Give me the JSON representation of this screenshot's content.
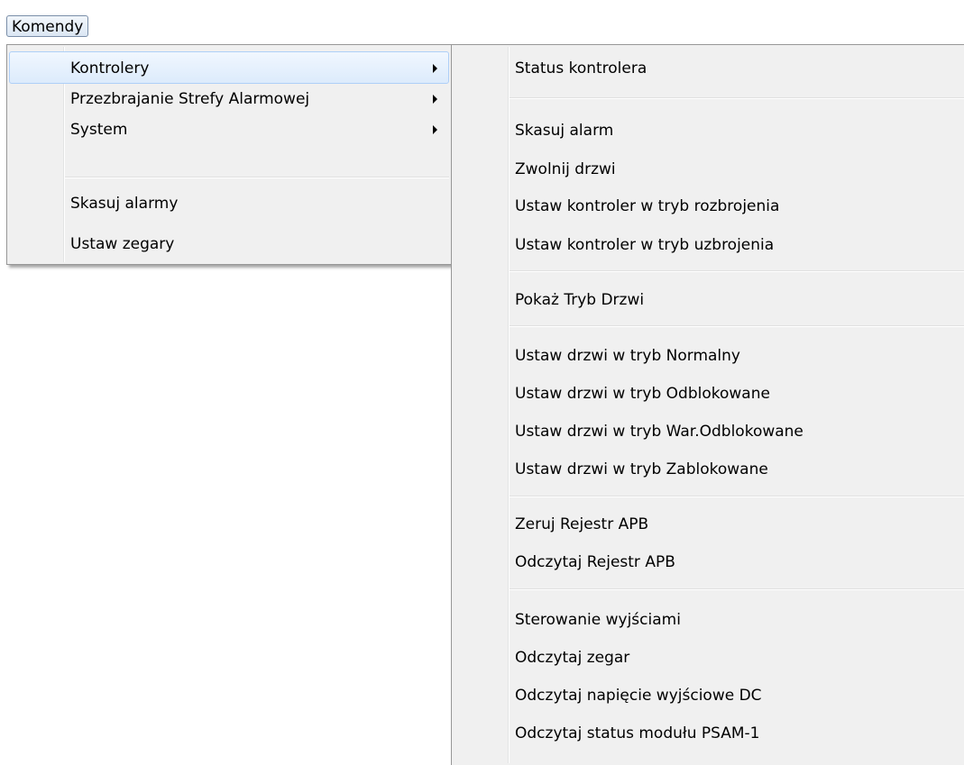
{
  "menubar": {
    "commands_label": "Komendy"
  },
  "main_menu": {
    "items": [
      {
        "label": "Kontrolery"
      },
      {
        "label": "Przezbrajanie Strefy Alarmowej"
      },
      {
        "label": "System"
      },
      {
        "label": "Skasuj alarmy"
      },
      {
        "label": "Ustaw zegary"
      }
    ]
  },
  "sub_menu": {
    "items": [
      {
        "label": "Status kontrolera"
      },
      {
        "label": "Skasuj alarm"
      },
      {
        "label": "Zwolnij drzwi"
      },
      {
        "label": "Ustaw kontroler w tryb rozbrojenia"
      },
      {
        "label": "Ustaw kontroler w tryb uzbrojenia"
      },
      {
        "label": "Pokaż Tryb Drzwi"
      },
      {
        "label": "Ustaw drzwi w tryb Normalny"
      },
      {
        "label": "Ustaw drzwi w tryb Odblokowane"
      },
      {
        "label": "Ustaw drzwi w tryb War.Odblokowane"
      },
      {
        "label": "Ustaw drzwi w tryb Zablokowane"
      },
      {
        "label": "Zeruj Rejestr APB"
      },
      {
        "label": "Odczytaj Rejestr APB"
      },
      {
        "label": "Sterowanie wyjściami"
      },
      {
        "label": "Odczytaj zegar"
      },
      {
        "label": "Odczytaj napięcie wyjściowe DC"
      },
      {
        "label": "Odczytaj status modułu PSAM-1"
      }
    ]
  },
  "colors": {
    "menu_background": "#f0f0f0",
    "highlight_border": "#aecff7",
    "highlight_fill": "#dcebfc"
  },
  "icons": {
    "submenu_arrow": "chevron-right-icon"
  }
}
